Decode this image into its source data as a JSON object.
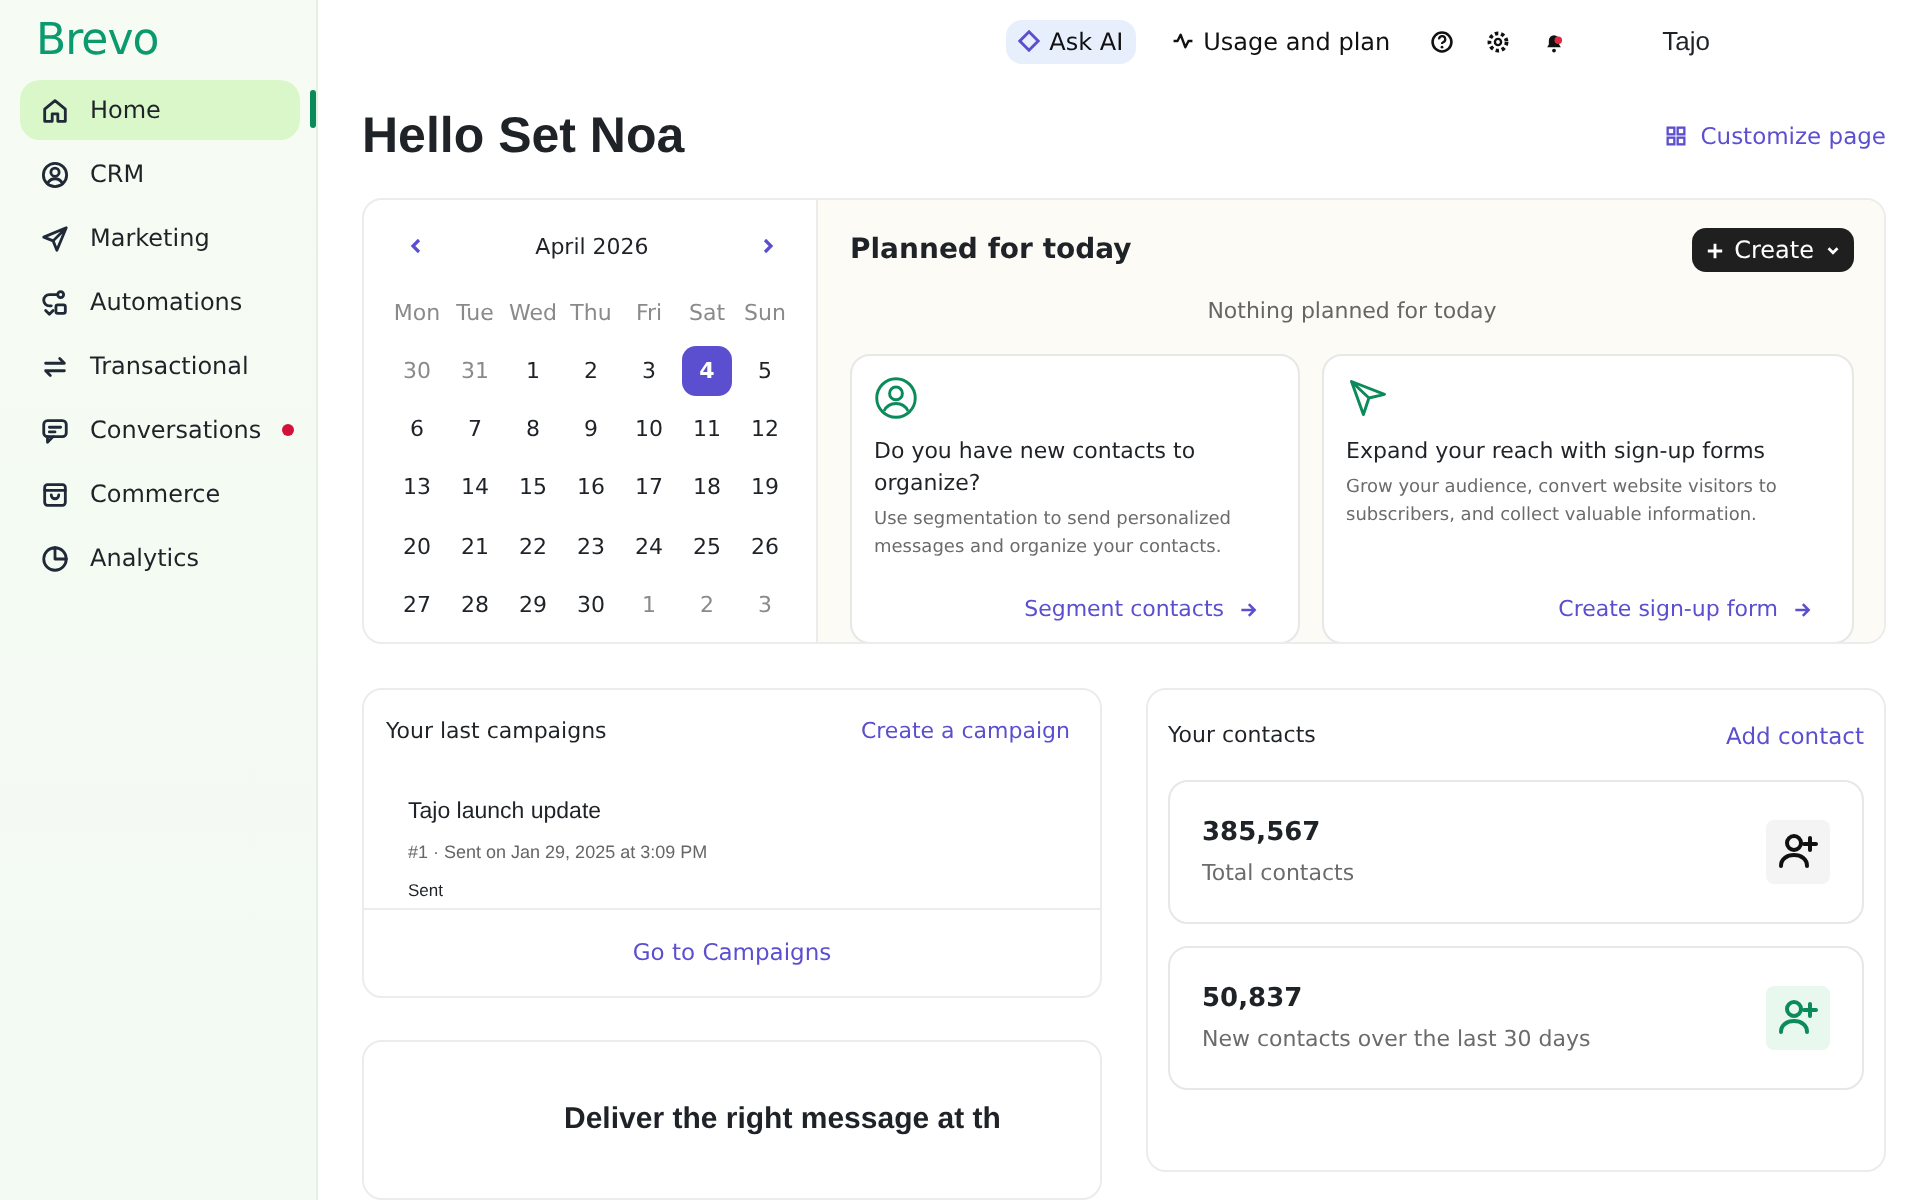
{
  "sidebar": {
    "logo": "Brevo",
    "items": [
      {
        "label": "Home",
        "selected": true,
        "notification": false
      },
      {
        "label": "CRM",
        "selected": false,
        "notification": false
      },
      {
        "label": "Marketing",
        "selected": false,
        "notification": false
      },
      {
        "label": "Automations",
        "selected": false,
        "notification": false
      },
      {
        "label": "Transactional",
        "selected": false,
        "notification": false
      },
      {
        "label": "Conversations",
        "selected": false,
        "notification": true
      },
      {
        "label": "Commerce",
        "selected": false,
        "notification": false
      },
      {
        "label": "Analytics",
        "selected": false,
        "notification": false
      }
    ]
  },
  "topbar": {
    "ask_ai": "Ask AI",
    "usage": "Usage and plan",
    "user": "Tajo"
  },
  "header": {
    "title": "Hello Set Noa",
    "customize": "Customize page"
  },
  "calendar": {
    "month": "April 2026",
    "weekdays": [
      "Mon",
      "Tue",
      "Wed",
      "Thu",
      "Fri",
      "Sat",
      "Sun"
    ],
    "weeks": [
      [
        {
          "label": "30",
          "muted": true,
          "selected": false
        },
        {
          "label": "31",
          "muted": true,
          "selected": false
        },
        {
          "label": "1",
          "muted": false,
          "selected": false
        },
        {
          "label": "2",
          "muted": false,
          "selected": false
        },
        {
          "label": "3",
          "muted": false,
          "selected": false
        },
        {
          "label": "4",
          "muted": false,
          "selected": true
        },
        {
          "label": "5",
          "muted": false,
          "selected": false
        }
      ],
      [
        {
          "label": "6",
          "muted": false,
          "selected": false
        },
        {
          "label": "7",
          "muted": false,
          "selected": false
        },
        {
          "label": "8",
          "muted": false,
          "selected": false
        },
        {
          "label": "9",
          "muted": false,
          "selected": false
        },
        {
          "label": "10",
          "muted": false,
          "selected": false
        },
        {
          "label": "11",
          "muted": false,
          "selected": false
        },
        {
          "label": "12",
          "muted": false,
          "selected": false
        }
      ],
      [
        {
          "label": "13",
          "muted": false,
          "selected": false
        },
        {
          "label": "14",
          "muted": false,
          "selected": false
        },
        {
          "label": "15",
          "muted": false,
          "selected": false
        },
        {
          "label": "16",
          "muted": false,
          "selected": false
        },
        {
          "label": "17",
          "muted": false,
          "selected": false
        },
        {
          "label": "18",
          "muted": false,
          "selected": false
        },
        {
          "label": "19",
          "muted": false,
          "selected": false
        }
      ],
      [
        {
          "label": "20",
          "muted": false,
          "selected": false
        },
        {
          "label": "21",
          "muted": false,
          "selected": false
        },
        {
          "label": "22",
          "muted": false,
          "selected": false
        },
        {
          "label": "23",
          "muted": false,
          "selected": false
        },
        {
          "label": "24",
          "muted": false,
          "selected": false
        },
        {
          "label": "25",
          "muted": false,
          "selected": false
        },
        {
          "label": "26",
          "muted": false,
          "selected": false
        }
      ],
      [
        {
          "label": "27",
          "muted": false,
          "selected": false
        },
        {
          "label": "28",
          "muted": false,
          "selected": false
        },
        {
          "label": "29",
          "muted": false,
          "selected": false
        },
        {
          "label": "30",
          "muted": false,
          "selected": false
        },
        {
          "label": "1",
          "muted": true,
          "selected": false
        },
        {
          "label": "2",
          "muted": true,
          "selected": false
        },
        {
          "label": "3",
          "muted": true,
          "selected": false
        }
      ]
    ]
  },
  "planned": {
    "title": "Planned for today",
    "create": "Create",
    "empty": "Nothing planned for today",
    "cards": [
      {
        "title": "Do you have new contacts to organize?",
        "text": "Use segmentation to send personalized messages and organize your contacts.",
        "link": "Segment contacts"
      },
      {
        "title": "Expand your reach with sign-up forms",
        "text": "Grow your audience, convert website visitors to subscribers, and collect valuable information.",
        "link": "Create sign-up form"
      }
    ]
  },
  "campaigns": {
    "title": "Your last campaigns",
    "create_link": "Create a campaign",
    "items": [
      {
        "name": "Tajo launch update",
        "meta": "#1 · Sent on Jan 29, 2025 at 3:09 PM",
        "status": "Sent"
      }
    ],
    "footer_link": "Go to Campaigns"
  },
  "contacts": {
    "title": "Your contacts",
    "add_link": "Add contact",
    "stats": [
      {
        "value": "385,567",
        "label": "Total contacts",
        "highlighted": false
      },
      {
        "value": "50,837",
        "label": "New contacts over the last 30 days",
        "highlighted": true
      }
    ]
  },
  "promo": {
    "title": "Deliver the right message at th"
  }
}
